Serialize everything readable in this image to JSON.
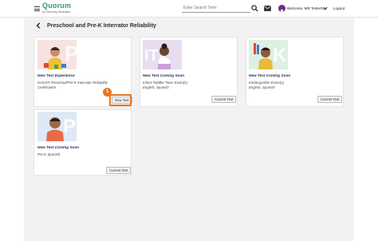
{
  "header": {
    "logo": "Quorum",
    "logo_sub": "by Teaching Strategies",
    "search_placeholder": "Enter Search Term",
    "welcome": "Welcome, MR Tester51!",
    "logout": "Logout"
  },
  "page": {
    "title": "Preschool and Pre-K Interrator Reliability"
  },
  "cards": [
    {
      "title": "New Test Experience",
      "desc_1": "GOLD® Preschool/Pre-K Interrator Reliability",
      "desc_2": "Certification",
      "button": "New Test",
      "image_icon": "toddler-blocks-photo",
      "image_letter": "P"
    },
    {
      "title": "New Test Coming Soon",
      "desc_1": "Infant-Toddler Twos Exam(s)",
      "desc_2": "English, Spanish",
      "button": "Current Test",
      "image_icon": "toddler-girl-photo",
      "image_letter": "IT2"
    },
    {
      "title": "New Test Coming Soon",
      "desc_1": "Kindergarden Exam(s)",
      "desc_2": "English, Spanish",
      "button": "Current Test",
      "image_icon": "child-colorful-photo",
      "image_letter": "K"
    },
    {
      "title": "New Test Coming Soon",
      "desc_1": "Pre-K Spanish-",
      "desc_2": "",
      "button": "Current Test",
      "image_icon": "boy-smiling-photo",
      "image_letter": "P"
    }
  ],
  "callout": {
    "step": "1"
  },
  "colors": {
    "brand_green": "#2a9d6f",
    "brand_purple": "#6c2a8f",
    "callout_orange": "#e87722",
    "title_navy": "#1e2a55"
  }
}
